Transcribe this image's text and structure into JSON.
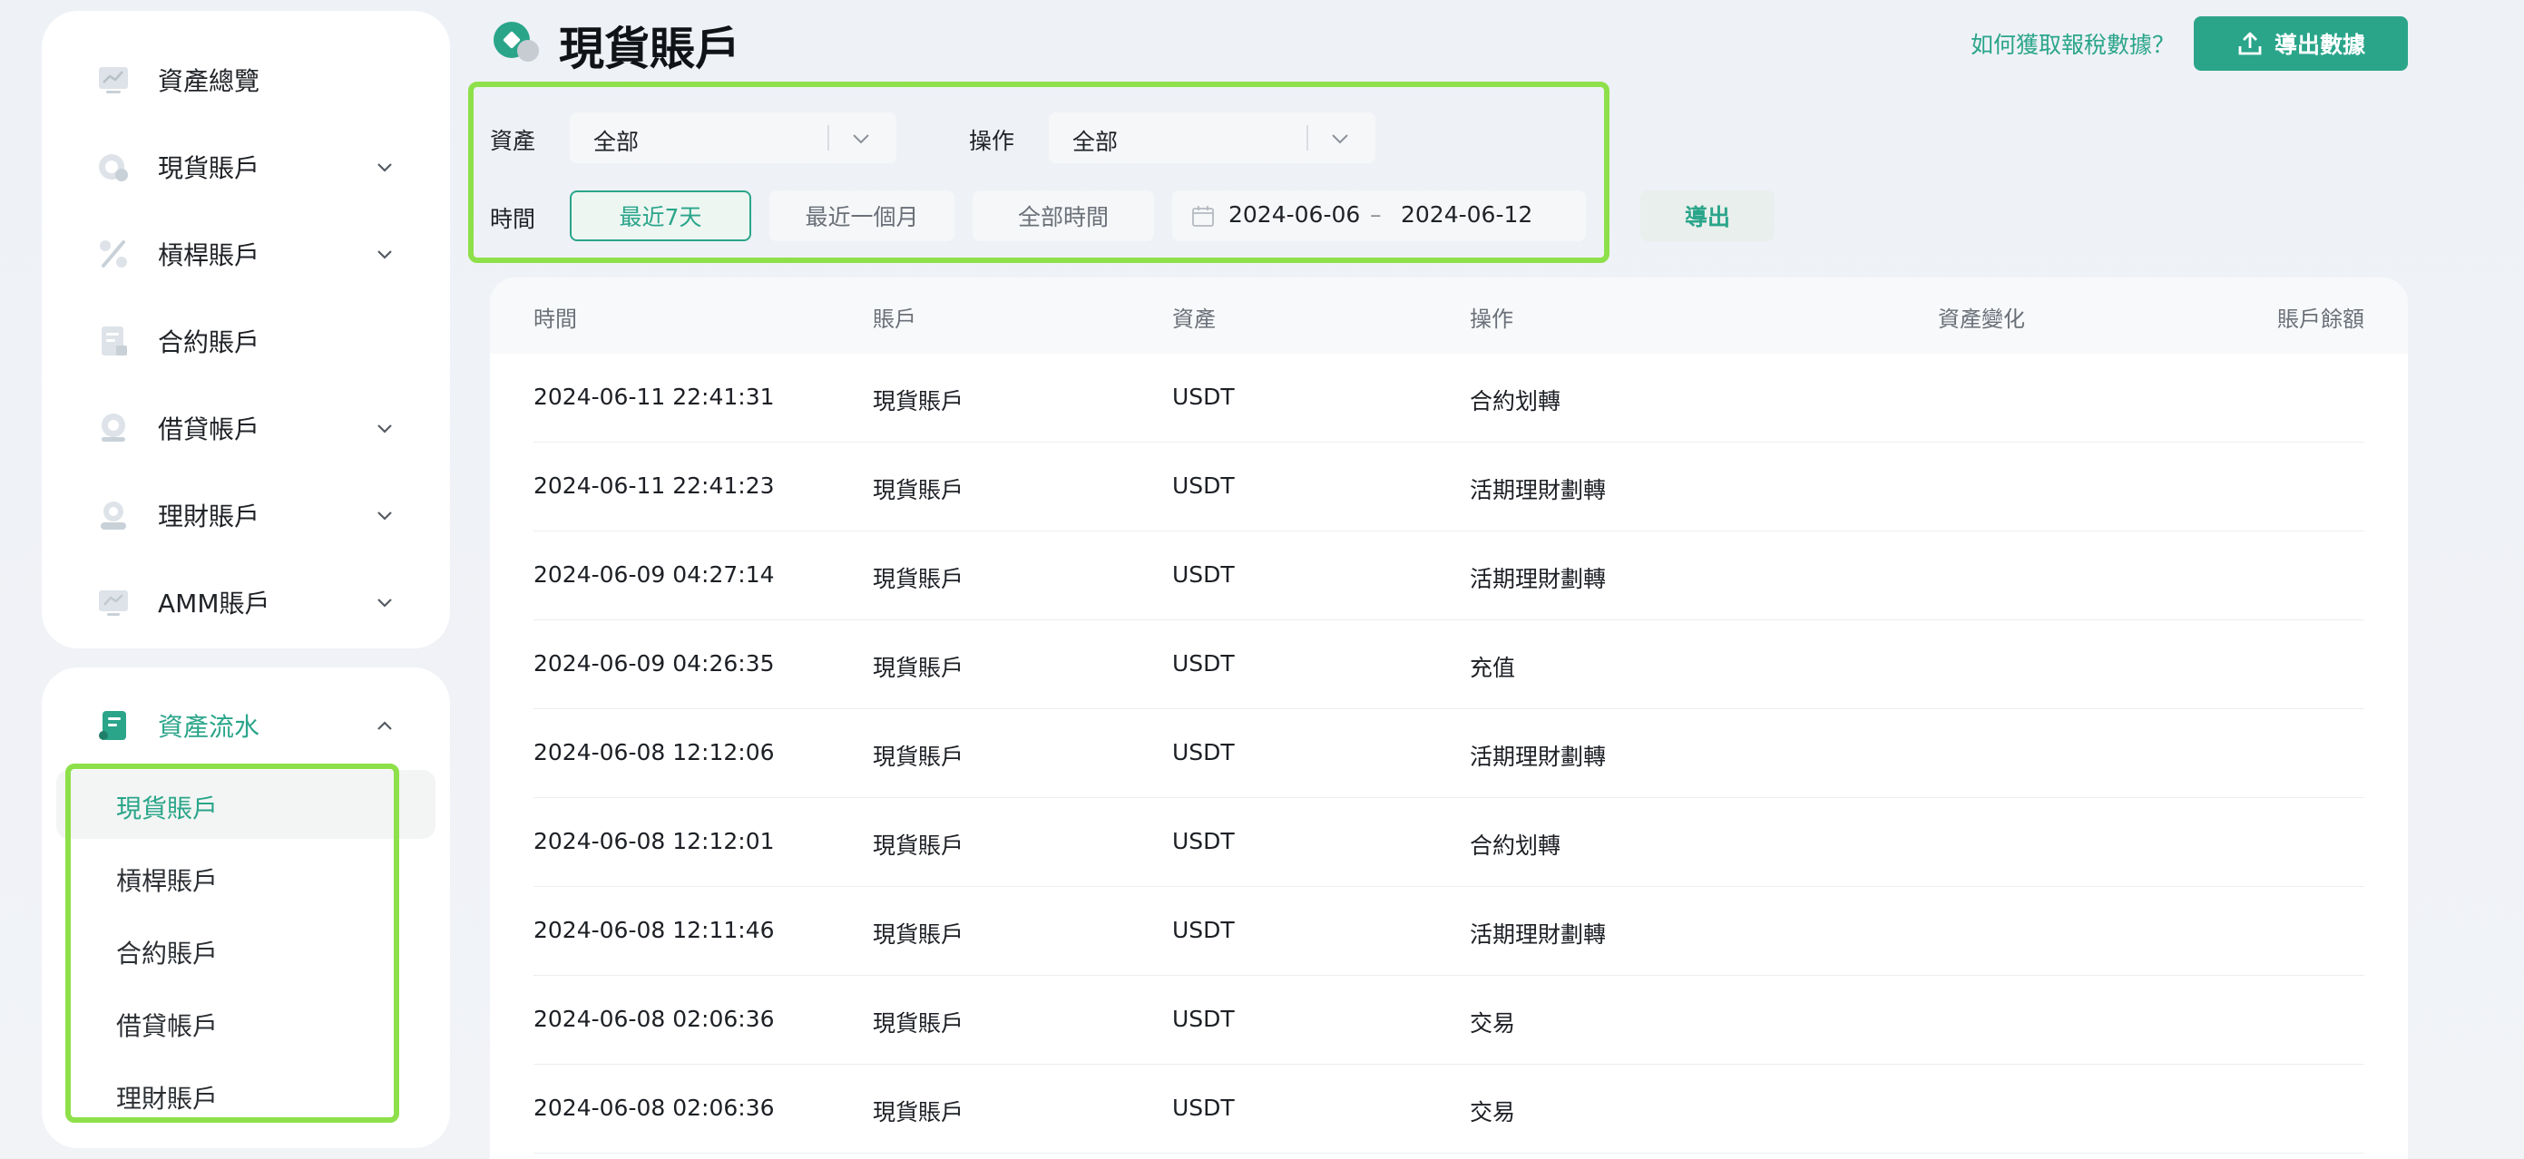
{
  "sidebar": {
    "items": [
      {
        "label": "資產總覽",
        "icon": "monitor-chart-icon",
        "has_chevron": false
      },
      {
        "label": "現貨賬戶",
        "icon": "coin-icon",
        "has_chevron": true
      },
      {
        "label": "槓桿賬戶",
        "icon": "percent-icon",
        "has_chevron": true
      },
      {
        "label": "合約賬戶",
        "icon": "document-icon",
        "has_chevron": false
      },
      {
        "label": "借貸帳戶",
        "icon": "coin-stack-icon",
        "has_chevron": true
      },
      {
        "label": "理財賬戶",
        "icon": "savings-icon",
        "has_chevron": true
      },
      {
        "label": "AMM賬戶",
        "icon": "monitor-icon",
        "has_chevron": true
      }
    ],
    "asset_flow": {
      "label": "資產流水",
      "sub_items": [
        "現貨賬戶",
        "槓桿賬戶",
        "合約賬戶",
        "借貸帳戶",
        "理財賬戶"
      ],
      "active_index": 0
    }
  },
  "header": {
    "title": "現貨賬戶",
    "help_link": "如何獲取報稅數據？",
    "export_data_label": "導出數據"
  },
  "filters": {
    "asset_label": "資產",
    "asset_value": "全部",
    "operation_label": "操作",
    "operation_value": "全部",
    "time_label": "時間",
    "ranges": [
      "最近7天",
      "最近一個月",
      "全部時間"
    ],
    "active_range_index": 0,
    "date_from": "2024-06-06",
    "date_separator": "–",
    "date_to": "2024-06-12",
    "export_label": "導出"
  },
  "table": {
    "columns": [
      "時間",
      "賬戶",
      "資產",
      "操作",
      "資產變化",
      "賬戶餘額"
    ],
    "rows": [
      {
        "time": "2024-06-11 22:41:31",
        "account": "現貨賬戶",
        "asset": "USDT",
        "operation": "合約划轉",
        "change": "",
        "balance": ""
      },
      {
        "time": "2024-06-11 22:41:23",
        "account": "現貨賬戶",
        "asset": "USDT",
        "operation": "活期理財劃轉",
        "change": "",
        "balance": ""
      },
      {
        "time": "2024-06-09 04:27:14",
        "account": "現貨賬戶",
        "asset": "USDT",
        "operation": "活期理財劃轉",
        "change": "",
        "balance": ""
      },
      {
        "time": "2024-06-09 04:26:35",
        "account": "現貨賬戶",
        "asset": "USDT",
        "operation": "充值",
        "change": "",
        "balance": ""
      },
      {
        "time": "2024-06-08 12:12:06",
        "account": "現貨賬戶",
        "asset": "USDT",
        "operation": "活期理財劃轉",
        "change": "",
        "balance": ""
      },
      {
        "time": "2024-06-08 12:12:01",
        "account": "現貨賬戶",
        "asset": "USDT",
        "operation": "合約划轉",
        "change": "",
        "balance": ""
      },
      {
        "time": "2024-06-08 12:11:46",
        "account": "現貨賬戶",
        "asset": "USDT",
        "operation": "活期理財劃轉",
        "change": "",
        "balance": ""
      },
      {
        "time": "2024-06-08 02:06:36",
        "account": "現貨賬戶",
        "asset": "USDT",
        "operation": "交易",
        "change": "",
        "balance": ""
      },
      {
        "time": "2024-06-08 02:06:36",
        "account": "現貨賬戶",
        "asset": "USDT",
        "operation": "交易",
        "change": "",
        "balance": ""
      }
    ]
  },
  "colors": {
    "accent": "#2aa58a",
    "highlight_frame": "#8ee04a"
  }
}
